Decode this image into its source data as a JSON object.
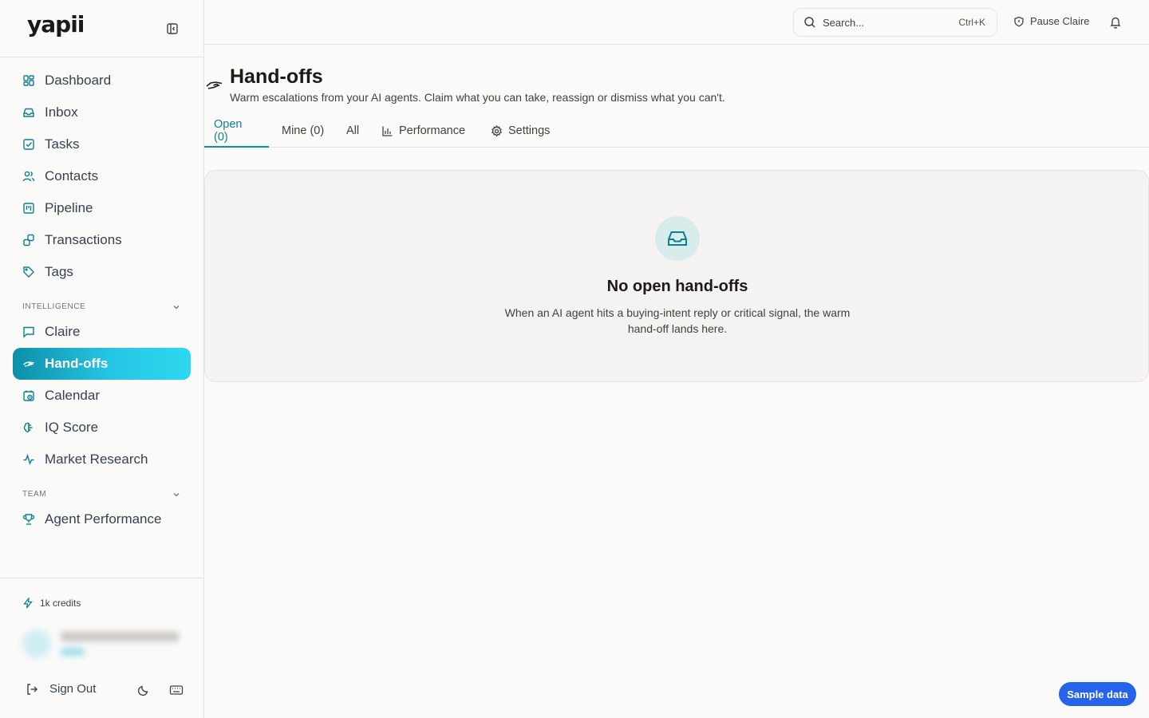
{
  "brand": {
    "logo": "yapii"
  },
  "sidebar": {
    "items": [
      {
        "key": "dashboard",
        "label": "Dashboard",
        "icon": "layout-grid-icon"
      },
      {
        "key": "inbox",
        "label": "Inbox",
        "icon": "inbox-icon"
      },
      {
        "key": "tasks",
        "label": "Tasks",
        "icon": "check-square-icon"
      },
      {
        "key": "contacts",
        "label": "Contacts",
        "icon": "users-icon"
      },
      {
        "key": "pipeline",
        "label": "Pipeline",
        "icon": "kanban-icon"
      },
      {
        "key": "transactions",
        "label": "Transactions",
        "icon": "transactions-icon"
      },
      {
        "key": "tags",
        "label": "Tags",
        "icon": "tag-icon"
      }
    ],
    "sections": {
      "intelligence": {
        "label": "INTELLIGENCE",
        "items": [
          {
            "key": "claire",
            "label": "Claire",
            "icon": "message-icon"
          },
          {
            "key": "handoffs",
            "label": "Hand-offs",
            "icon": "handshake-icon",
            "active": true
          },
          {
            "key": "calendar",
            "label": "Calendar",
            "icon": "calendar-clock-icon"
          },
          {
            "key": "iq-score",
            "label": "IQ Score",
            "icon": "brain-icon"
          },
          {
            "key": "market-research",
            "label": "Market Research",
            "icon": "activity-icon"
          }
        ]
      },
      "team": {
        "label": "TEAM",
        "items": [
          {
            "key": "agent-performance",
            "label": "Agent Performance",
            "icon": "trophy-icon"
          }
        ]
      }
    },
    "footer": {
      "credits": "1k credits",
      "sign_out": "Sign Out"
    }
  },
  "topbar": {
    "search_placeholder": "Search...",
    "search_shortcut": "Ctrl+K",
    "pause_label": "Pause Claire"
  },
  "page": {
    "title": "Hand-offs",
    "subtitle": "Warm escalations from your AI agents. Claim what you can take, reassign or dismiss what you can't.",
    "tabs": [
      {
        "key": "open",
        "label": "Open (0)",
        "active": true
      },
      {
        "key": "mine",
        "label": "Mine (0)"
      },
      {
        "key": "all",
        "label": "All"
      },
      {
        "key": "performance",
        "label": "Performance",
        "icon": "bar-chart-icon"
      },
      {
        "key": "settings",
        "label": "Settings",
        "icon": "gear-icon"
      }
    ],
    "empty_state": {
      "title": "No open hand-offs",
      "description": "When an AI agent hits a buying-intent reply or critical signal, the warm hand-off lands here."
    }
  },
  "sample_button": "Sample data",
  "colors": {
    "accent": "#0e8fa8",
    "accent_light": "#2dd8ef",
    "icon_teal": "#0e7f95",
    "sample_button": "#2563eb"
  }
}
